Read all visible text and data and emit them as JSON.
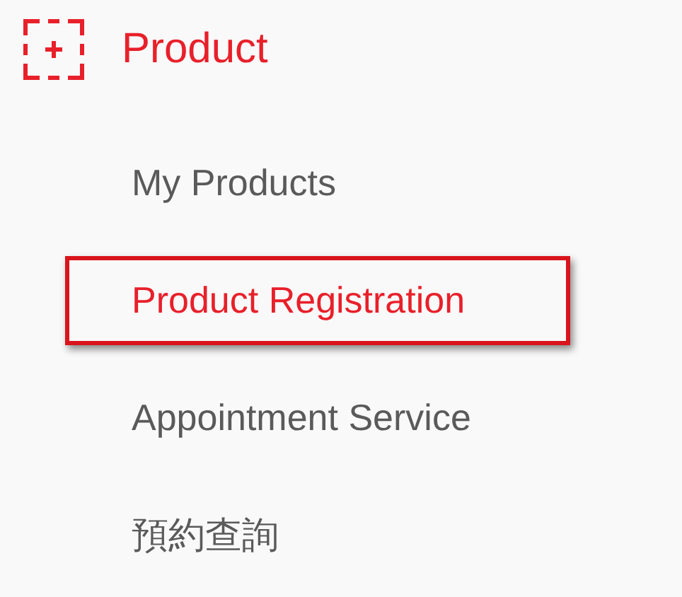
{
  "header": {
    "title": "Product"
  },
  "menu": [
    {
      "label": "My Products",
      "selected": false
    },
    {
      "label": "Product Registration",
      "selected": true
    },
    {
      "label": "Appointment Service",
      "selected": false
    },
    {
      "label": "預約查詢",
      "selected": false
    }
  ]
}
